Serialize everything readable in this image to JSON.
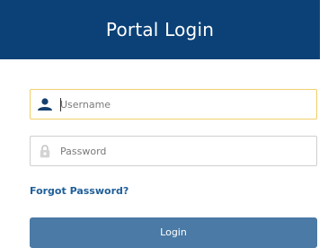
{
  "header": {
    "title": "Portal Login"
  },
  "username": {
    "placeholder": "Username",
    "value": "",
    "icon": "user-icon"
  },
  "password": {
    "placeholder": "Password",
    "value": "",
    "icon": "lock-icon"
  },
  "forgot_link": "Forgot Password?",
  "login_button": "Login",
  "colors": {
    "header_bg": "#0b4176",
    "focus_border": "#f0cf6a",
    "link": "#1f5f99",
    "button_bg": "#4a7aa5"
  }
}
